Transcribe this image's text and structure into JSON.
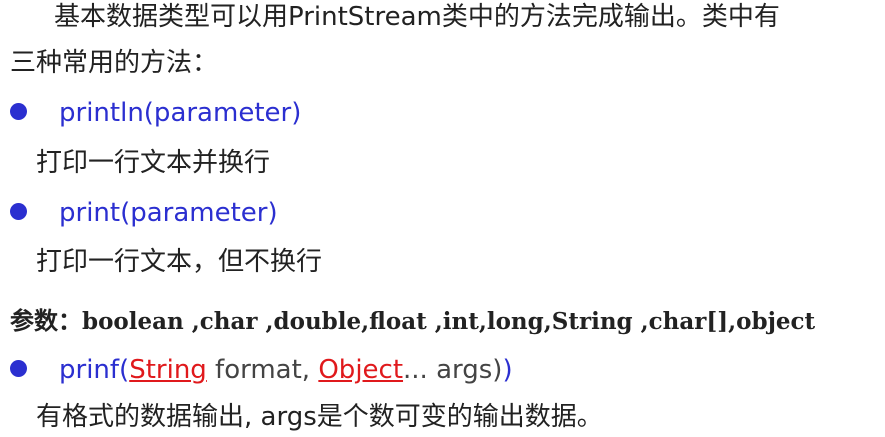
{
  "intro": {
    "line1": "基本数据类型可以用PrintStream类中的方法完成输出。类中有",
    "line2": "三种常用的方法："
  },
  "methods": [
    {
      "signature": "println(parameter)",
      "description": "打印一行文本并换行"
    },
    {
      "signature": "print(parameter)",
      "description": "打印一行文本，但不换行"
    }
  ],
  "params": {
    "label": "参数：",
    "list": "boolean ,char ,double,float ,int,long,String ,char[],object"
  },
  "printf": {
    "prefix": "prinf(",
    "type1": "String",
    "arg1": " format, ",
    "type2": "Object",
    "arg2": "... args)",
    "suffix": ")",
    "description": "有格式的数据输出, args是个数可变的输出数据。"
  },
  "colors": {
    "method_blue": "#2b2fd0",
    "type_red": "#e0191c",
    "text": "#222222"
  }
}
